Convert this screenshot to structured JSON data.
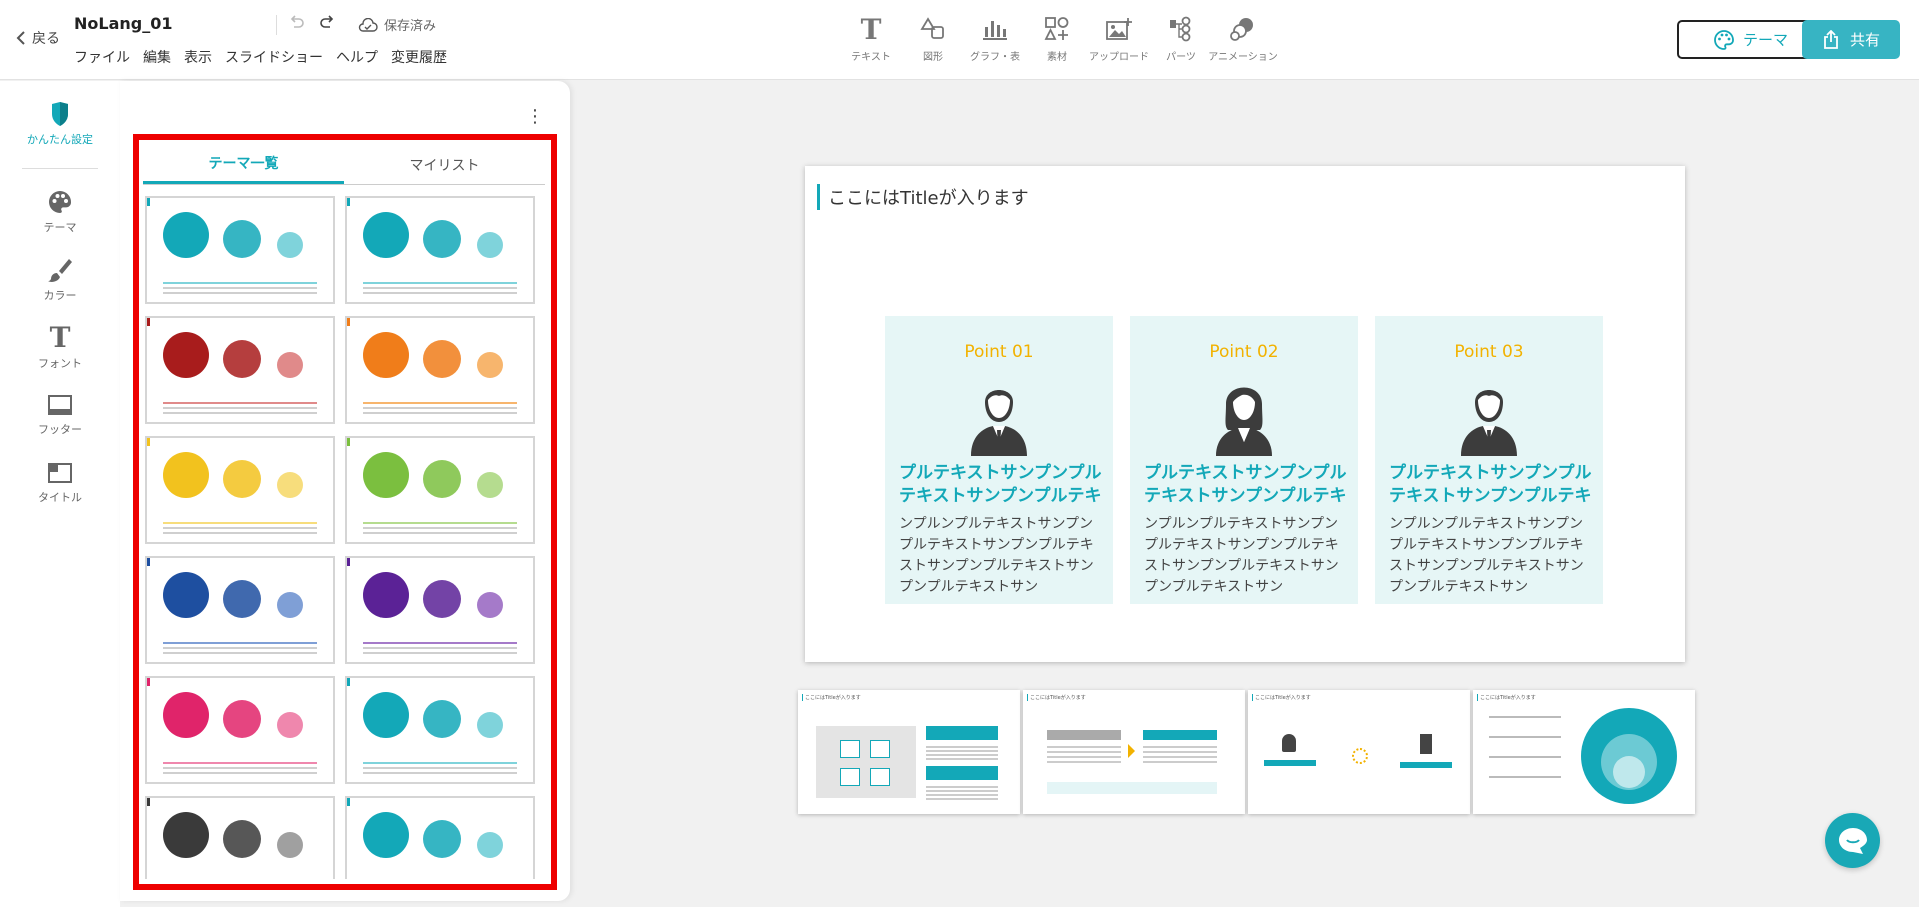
{
  "header": {
    "back_label": "戻る",
    "doc_title": "NoLang_01",
    "saved_label": "保存済み",
    "menu": [
      "ファイル",
      "編集",
      "表示",
      "スライドショー",
      "ヘルプ",
      "変更履歴"
    ],
    "tools": [
      {
        "label": "テキスト",
        "icon": "text-icon"
      },
      {
        "label": "図形",
        "icon": "shape-icon"
      },
      {
        "label": "グラフ・表",
        "icon": "chart-icon"
      },
      {
        "label": "素材",
        "icon": "material-icon"
      },
      {
        "label": "アップロード",
        "icon": "upload-icon"
      },
      {
        "label": "パーツ",
        "icon": "parts-icon"
      },
      {
        "label": "アニメーション",
        "icon": "animation-icon"
      }
    ],
    "theme_button": "テーマ",
    "share_button": "共有"
  },
  "rail": {
    "items": [
      {
        "label": "かんたん設定",
        "icon": "shield-icon"
      },
      {
        "label": "テーマ",
        "icon": "palette-icon"
      },
      {
        "label": "カラー",
        "icon": "brush-icon"
      },
      {
        "label": "フォント",
        "icon": "font-icon"
      },
      {
        "label": "フッター",
        "icon": "footer-icon"
      },
      {
        "label": "タイトル",
        "icon": "title-layout-icon"
      }
    ]
  },
  "panel": {
    "tabs": [
      "テーマ一覧",
      "マイリスト"
    ],
    "themes": [
      {
        "color": "#13a8b8",
        "light": "#7fd3db"
      },
      {
        "color": "#13a8b8",
        "light": "#7fd3db"
      },
      {
        "color": "#a81c1c",
        "light": "#e08a8a"
      },
      {
        "color": "#f07d1a",
        "light": "#f7b56d"
      },
      {
        "color": "#f2c21e",
        "light": "#f7dd7c"
      },
      {
        "color": "#7bbf3f",
        "light": "#b5dc8f"
      },
      {
        "color": "#1e4fa0",
        "light": "#7f9fd6"
      },
      {
        "color": "#5b2296",
        "light": "#a57ac9"
      },
      {
        "color": "#e0246a",
        "light": "#ef87ad"
      },
      {
        "color": "#13a8b8",
        "light": "#7fd3db"
      },
      {
        "color": "#3a3a3a",
        "light": "#a0a0a0"
      },
      {
        "color": "#13a8b8",
        "light": "#7fd3db"
      }
    ]
  },
  "slide": {
    "title": "ここにはTitleが入ります",
    "points": [
      {
        "label": "Point 01",
        "heading": "プルテキストサンプンプルテキストサンプンプルテキ",
        "body": "ンプルンプルテキストサンプンプルテキストサンプンプルテキストサンプンプルテキストサンプンプルテキストサン"
      },
      {
        "label": "Point 02",
        "heading": "プルテキストサンプンプルテキストサンプンプルテキ",
        "body": "ンプルンプルテキストサンプンプルテキストサンプンプルテキストサンプンプルテキストサンプンプルテキストサン"
      },
      {
        "label": "Point 03",
        "heading": "プルテキストサンプンプルテキストサンプンプルテキ",
        "body": "ンプルンプルテキストサンプンプルテキストサンプンプルテキストサンプンプルテキストサンプンプルテキストサン"
      }
    ]
  },
  "thumbnails": [
    "ここにはTitleが入ります",
    "ここにはTitleが入ります",
    "ここにはTitleが入ります",
    "ここにはTitleが入ります"
  ],
  "colors": {
    "accent": "#13a8b8",
    "point_label": "#f2b200",
    "point_bg": "#e6f6f6",
    "selection": "#ee0000"
  }
}
